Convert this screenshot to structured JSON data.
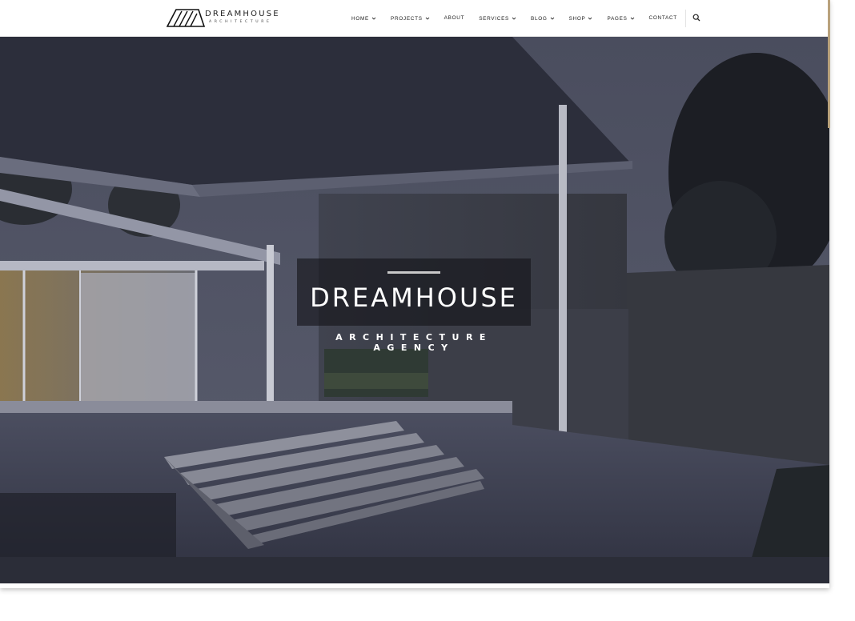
{
  "brand": {
    "name": "DREAMHOUSE",
    "tagline": "ARCHITECTURE"
  },
  "nav": {
    "items": [
      {
        "label": "HOME",
        "dropdown": true
      },
      {
        "label": "PROJECTS",
        "dropdown": true
      },
      {
        "label": "ABOUT",
        "dropdown": false
      },
      {
        "label": "SERVICES",
        "dropdown": true
      },
      {
        "label": "BLOG",
        "dropdown": true
      },
      {
        "label": "SHOP",
        "dropdown": true
      },
      {
        "label": "PAGES",
        "dropdown": true
      },
      {
        "label": "CONTACT",
        "dropdown": false
      }
    ],
    "search_icon": "search-icon"
  },
  "hero": {
    "title": "DREAMHOUSE",
    "subtitle": "ARCHITECTURE AGENCY",
    "image": "modern-house-dusk"
  },
  "colors": {
    "accent_strip": "#b9a27c",
    "overlay": "#141418",
    "text_dark": "#222222"
  }
}
